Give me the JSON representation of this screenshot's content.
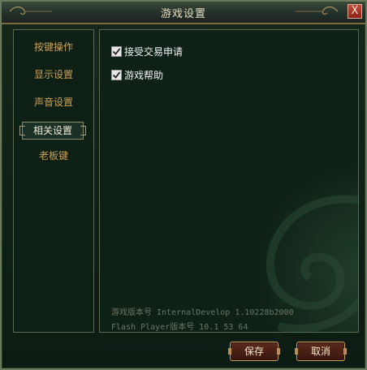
{
  "window": {
    "title": "游戏设置",
    "close_label": "X"
  },
  "sidebar": {
    "items": [
      {
        "label": "按键操作",
        "active": false
      },
      {
        "label": "显示设置",
        "active": false
      },
      {
        "label": "声音设置",
        "active": false
      },
      {
        "label": "相关设置",
        "active": true
      },
      {
        "label": "老板键",
        "active": false
      }
    ]
  },
  "main": {
    "options": [
      {
        "label": "接受交易申请",
        "checked": true
      },
      {
        "label": "游戏帮助",
        "checked": true
      }
    ],
    "version_lines": [
      "游戏版本号 InternalDevelop 1.10228b2000",
      "Flash Player版本号 10.1 53 64"
    ]
  },
  "buttons": {
    "save": "保存",
    "cancel": "取消"
  },
  "colors": {
    "accent_gold": "#c9a25a",
    "panel_border": "#5a6a50",
    "button_red": "#5a2a1c"
  }
}
